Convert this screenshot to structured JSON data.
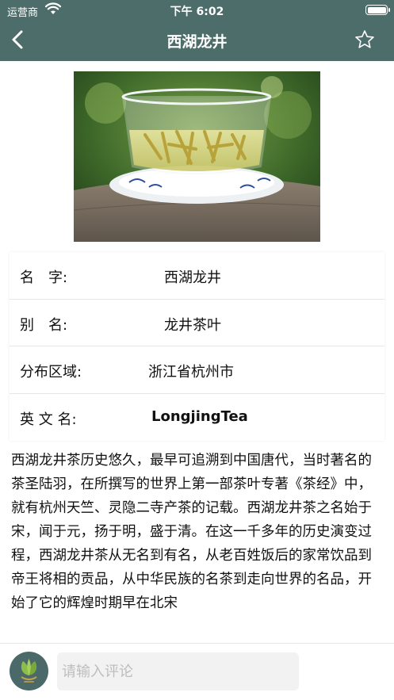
{
  "status_bar": {
    "carrier": "运营商",
    "time": "下午 6:02"
  },
  "nav": {
    "title": "西湖龙井"
  },
  "info": [
    {
      "label": "名　字:",
      "value": "西湖龙井"
    },
    {
      "label": "别　名:",
      "value": "龙井茶叶"
    },
    {
      "label": "分布区域:",
      "value": "浙江省杭州市"
    },
    {
      "label": "英 文 名:",
      "value": "LongjingTea"
    }
  ],
  "description": "西湖龙井茶历史悠久，最早可追溯到中国唐代，当时著名的茶圣陆羽，在所撰写的世界上第一部茶叶专著《茶经》中，就有杭州天竺、灵隐二寺产茶的记载。西湖龙井茶之名始于宋，闻于元，扬于明，盛于清。在这一千多年的历史演变过程，西湖龙井茶从无名到有名，从老百姓饭后的家常饮品到帝王将相的贡品，从中华民族的名茶到走向世界的名品，开始了它的辉煌时期早在北宋",
  "comment": {
    "placeholder": "请输入评论"
  },
  "colors": {
    "nav_bg": "#4d6d6b",
    "avatar_bg": "#4a6968"
  },
  "icons": [
    "wifi-icon",
    "battery-icon",
    "back-arrow-icon",
    "star-outline-icon",
    "tea-leaf-icon"
  ]
}
